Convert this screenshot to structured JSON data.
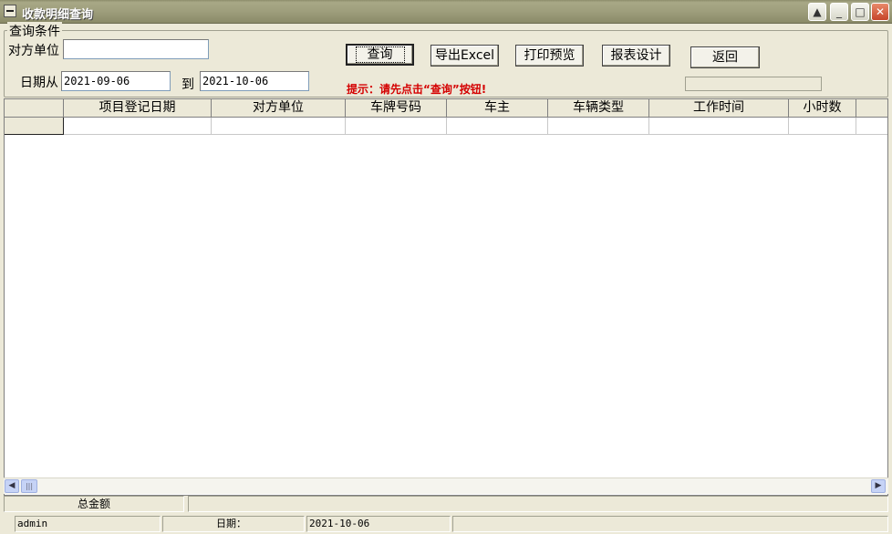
{
  "window": {
    "title": "收款明细查询",
    "buttons": {
      "help": "▲",
      "minimize": "_",
      "maximize": "□",
      "close": "✕"
    }
  },
  "query": {
    "group_title": "查询条件",
    "counterparty_label": "对方单位",
    "counterparty_value": "",
    "date_from_label": "日期从",
    "date_from": "2021-09-06",
    "date_to_label": "到",
    "date_to": "2021-10-06",
    "hint": "提示：请先点击“查询”按钮!"
  },
  "toolbar": {
    "query": "查询",
    "export": "导出Excel",
    "print_preview": "打印预览",
    "report_design": "报表设计",
    "back": "返回"
  },
  "grid": {
    "columns": [
      "项目登记日期",
      "对方单位",
      "车牌号码",
      "车主",
      "车辆类型",
      "工作时间",
      "小时数"
    ]
  },
  "totals": {
    "label": "总金额",
    "value": ""
  },
  "status": {
    "user": "admin",
    "date_label": "日期：",
    "date": "2021-10-06"
  }
}
